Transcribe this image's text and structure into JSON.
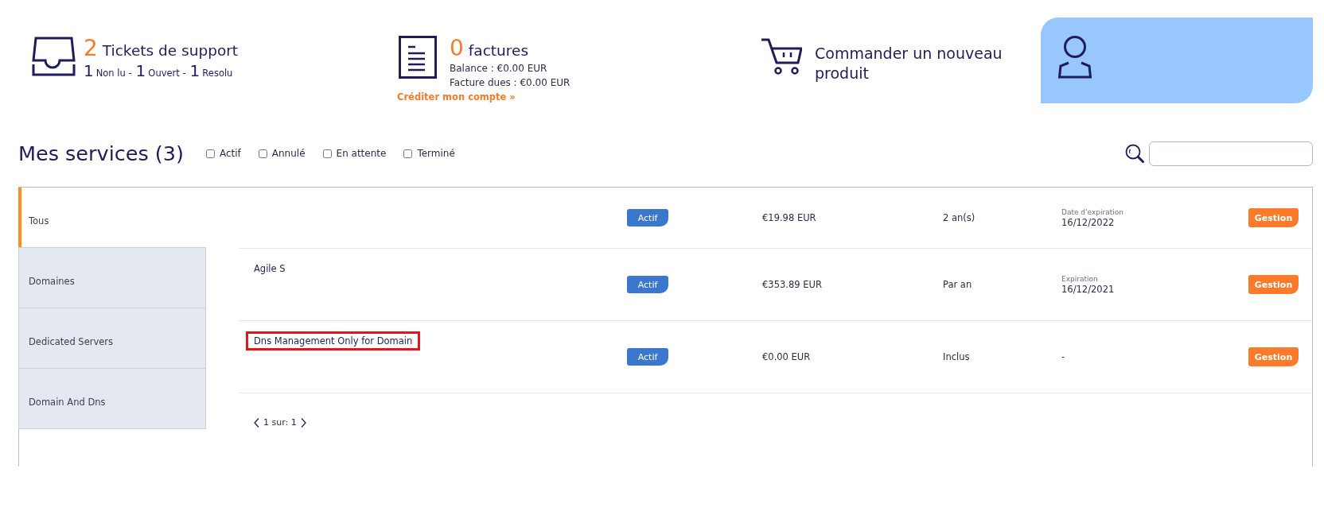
{
  "summary": {
    "tickets": {
      "count": "2",
      "title": "Tickets de support",
      "statuses": [
        {
          "count": "1",
          "label": "Non lu -"
        },
        {
          "count": "1",
          "label": "Ouvert -"
        },
        {
          "count": "1",
          "label": "Resolu"
        }
      ]
    },
    "invoices": {
      "count": "0",
      "title": "factures",
      "lines": [
        "Balance : €0.00 EUR",
        "Facture dues : €0.00 EUR"
      ],
      "link": "Créditer mon compte »"
    },
    "order": {
      "label": "Commander un nouveau produit"
    }
  },
  "services": {
    "title": "Mes services (3)",
    "filters": [
      {
        "label": "Actif",
        "checked": false
      },
      {
        "label": "Annulé",
        "checked": false
      },
      {
        "label": "En attente",
        "checked": false
      },
      {
        "label": "Terminé",
        "checked": false
      }
    ],
    "categories": [
      {
        "label": "Tous",
        "selected": true
      },
      {
        "label": "Domaines",
        "selected": false
      },
      {
        "label": "Dedicated Servers",
        "selected": false
      },
      {
        "label": "Domain And Dns",
        "selected": false
      }
    ],
    "rows": [
      {
        "status": "Actif",
        "price": "€19.98 EUR",
        "cycle": "2 an(s)",
        "expiry_label": "Date d'expiration",
        "expiry": "16/12/2022",
        "action": "Gestion",
        "highlighted": false
      },
      {
        "name": "Agile S",
        "status": "Actif",
        "price": "€353.89 EUR",
        "cycle": "Par an",
        "expiry_label": "Expiration",
        "expiry": "16/12/2021",
        "action": "Gestion",
        "highlighted": false
      },
      {
        "name": "Dns Management Only for Domain",
        "status": "Actif",
        "price": "€0.00 EUR",
        "cycle": "Inclus",
        "expiry": "-",
        "action": "Gestion",
        "highlighted": true
      }
    ],
    "pagination": {
      "label": "1 sur: 1"
    }
  }
}
